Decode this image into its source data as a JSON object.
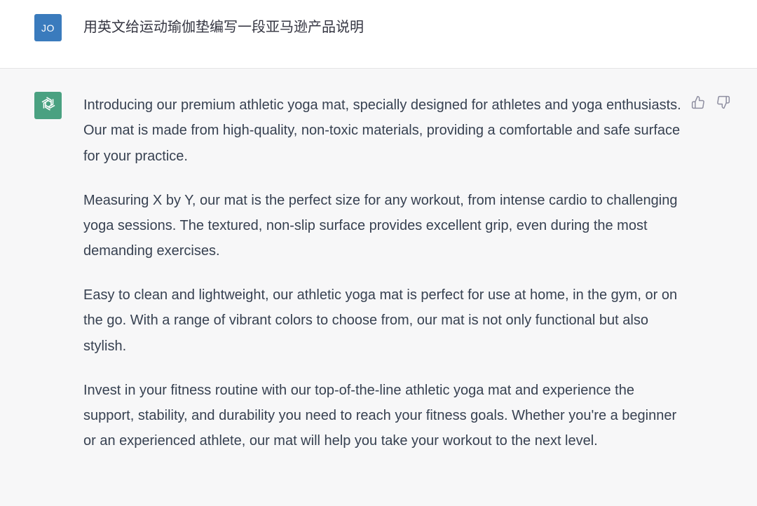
{
  "user_message": {
    "avatar_initials": "JO",
    "text": "用英文给运动瑜伽垫编写一段亚马逊产品说明"
  },
  "assistant_message": {
    "avatar_icon": "openai-logo-icon",
    "feedback": {
      "like_icon": "thumbs-up-icon",
      "dislike_icon": "thumbs-down-icon"
    },
    "paragraphs": [
      "Introducing our premium athletic yoga mat, specially designed for athletes and yoga enthusiasts. Our mat is made from high-quality, non-toxic materials, providing a comfortable and safe surface for your practice.",
      "Measuring X by Y, our mat is the perfect size for any workout, from intense cardio to challenging yoga sessions. The textured, non-slip surface provides excellent grip, even during the most demanding exercises.",
      "Easy to clean and lightweight, our athletic yoga mat is perfect for use at home, in the gym, or on the go. With a range of vibrant colors to choose from, our mat is not only functional but also stylish.",
      "Invest in your fitness routine with our top-of-the-line athletic yoga mat and experience the support, stability, and durability you need to reach your fitness goals. Whether you're a beginner or an experienced athlete, our mat will help you take your workout to the next level."
    ]
  },
  "colors": {
    "user_avatar_bg": "#3a7bbd",
    "bot_avatar_bg": "#4aa181",
    "assistant_row_bg": "#f7f7f8",
    "user_row_bg": "#ffffff",
    "text": "#374151"
  }
}
